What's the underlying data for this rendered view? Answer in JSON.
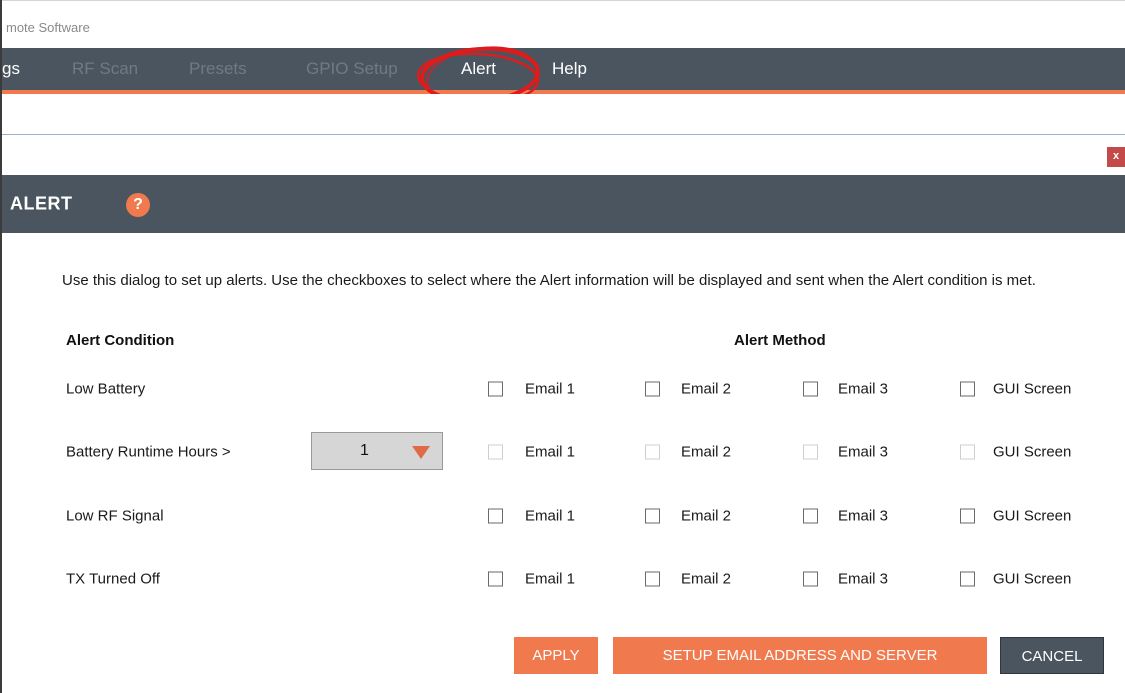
{
  "window": {
    "title": "mote Software"
  },
  "menu": {
    "items": [
      {
        "label": "gs"
      },
      {
        "label": "RF Scan"
      },
      {
        "label": "Presets"
      },
      {
        "label": "GPIO Setup"
      },
      {
        "label": "Alert"
      },
      {
        "label": "Help"
      }
    ],
    "active": "Alert"
  },
  "close_label": "x",
  "dialog": {
    "title": "ALERT",
    "help_label": "?",
    "description": "Use this dialog to set up alerts. Use the checkboxes to select where the Alert information will be displayed and sent when the Alert condition is met.",
    "condition_header": "Alert Condition",
    "method_header": "Alert Method",
    "methods": [
      "Email 1",
      "Email 2",
      "Email 3",
      "GUI Screen"
    ],
    "rows": [
      {
        "label": "Low Battery",
        "enabled": true,
        "checked": [
          false,
          false,
          false,
          false
        ]
      },
      {
        "label": "Battery Runtime Hours  >",
        "enabled": false,
        "checked": [
          false,
          false,
          false,
          false
        ],
        "dropdown_value": "1"
      },
      {
        "label": "Low RF Signal",
        "enabled": true,
        "checked": [
          false,
          false,
          false,
          false
        ]
      },
      {
        "label": "TX Turned Off",
        "enabled": true,
        "checked": [
          false,
          false,
          false,
          false
        ]
      }
    ],
    "buttons": {
      "apply": "APPLY",
      "setup": "SETUP EMAIL ADDRESS AND SERVER",
      "cancel": "CANCEL"
    }
  },
  "colors": {
    "accent": "#f07a4e",
    "header": "#4a5560",
    "highlight_circle": "#e01b1b"
  }
}
